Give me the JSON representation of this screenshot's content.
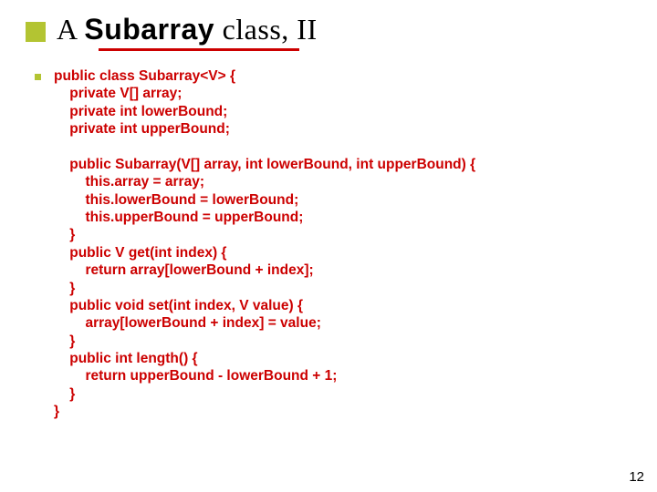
{
  "title": {
    "prefix_serif": "A ",
    "bold_sans": "Subarray",
    "suffix_serif": " class, II"
  },
  "code": {
    "l1": "public class Subarray<V> {",
    "l2": "    private V[] array;",
    "l3": "    private int lowerBound;",
    "l4": "    private int upperBound;",
    "l5": "",
    "l6": "    public Subarray(V[] array, int lowerBound, int upperBound) {",
    "l7": "        this.array = array;",
    "l8": "        this.lowerBound = lowerBound;",
    "l9": "        this.upperBound = upperBound;",
    "l10": "    }",
    "l11": "    public V get(int index) {",
    "l12": "        return array[lowerBound + index];",
    "l13": "    }",
    "l14": "    public void set(int index, V value) {",
    "l15": "        array[lowerBound + index] = value;",
    "l16": "    }",
    "l17": "    public int length() {",
    "l18": "        return upperBound - lowerBound + 1;",
    "l19": "    }",
    "l20": "}"
  },
  "page_number": "12"
}
